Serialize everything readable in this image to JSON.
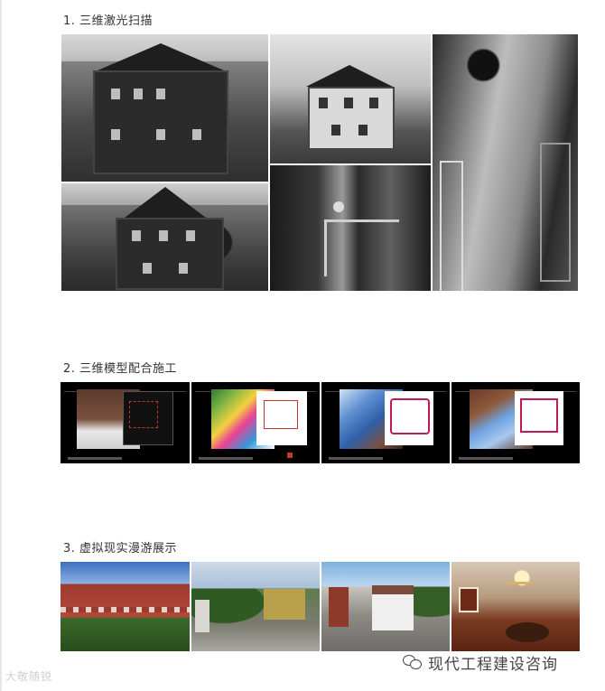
{
  "sections": [
    {
      "title": "1. 三维激光扫描"
    },
    {
      "title": "2. 三维模型配合施工"
    },
    {
      "title": "3. 虚拟现实漫游展示"
    }
  ],
  "watermarks": {
    "brand_text": "现代工程建设咨询",
    "left_text": "大敬随锐",
    "brand_icon": "wechat-icon"
  }
}
